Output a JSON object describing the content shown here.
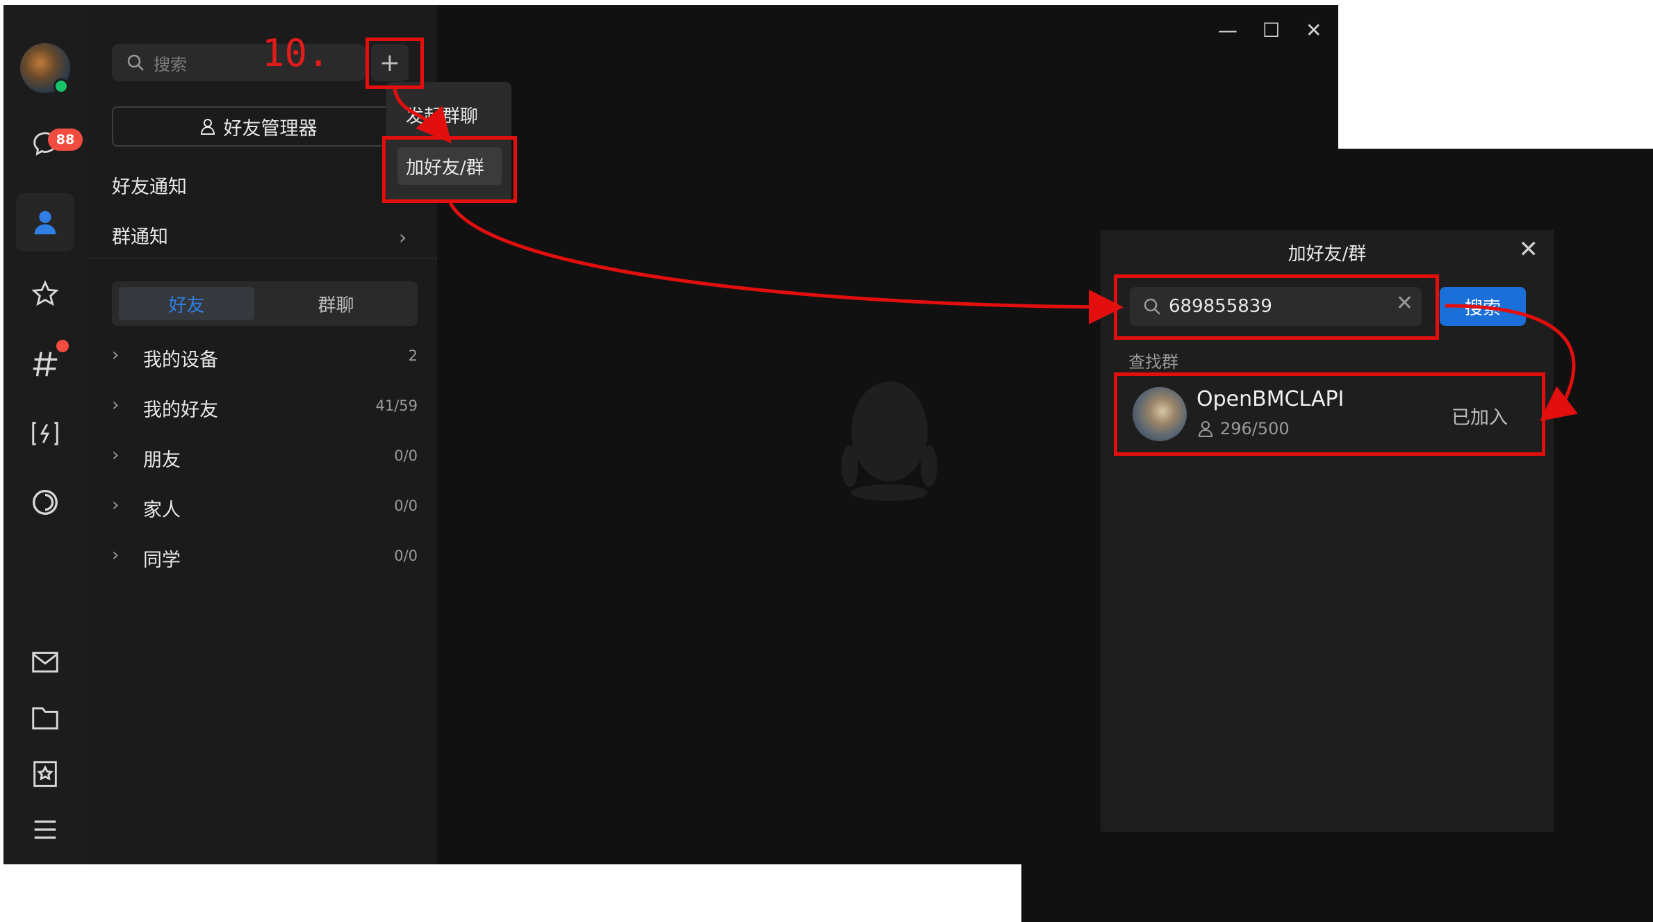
{
  "sidebar": {
    "unread_badge": "88",
    "icons": [
      "chat-icon",
      "contacts-icon",
      "star-icon",
      "hash-icon",
      "game-icon",
      "circle-icon",
      "mail-icon",
      "folder-icon",
      "bookmark-icon",
      "menu-icon"
    ]
  },
  "panel": {
    "search_placeholder": "搜索",
    "step_label": "10.",
    "plus_label": "+",
    "friend_manager": "好友管理器",
    "friend_notice": "好友通知",
    "group_notice": "群通知",
    "tabs": {
      "friends": "好友",
      "groups": "群聊"
    },
    "groups": [
      {
        "name": "我的设备",
        "count": "2"
      },
      {
        "name": "我的好友",
        "count": "41/59"
      },
      {
        "name": "朋友",
        "count": "0/0"
      },
      {
        "name": "家人",
        "count": "0/0"
      },
      {
        "name": "同学",
        "count": "0/0"
      }
    ]
  },
  "menu": {
    "items": [
      "发起群聊",
      "加好友/群"
    ]
  },
  "window_controls": {
    "minimize": "—",
    "maximize": "☐",
    "close": "✕"
  },
  "dialog": {
    "title": "加好友/群",
    "close": "✕",
    "search_value": "689855839",
    "clear": "✕",
    "search_button": "搜索",
    "section": "查找群",
    "result": {
      "name": "OpenBMCLAPI",
      "members": "296/500",
      "status": "已加入"
    }
  },
  "colors": {
    "annotation": "#e30f0f",
    "accent": "#1a6fd8",
    "badge": "#f24b3f",
    "online": "#18c46b"
  }
}
